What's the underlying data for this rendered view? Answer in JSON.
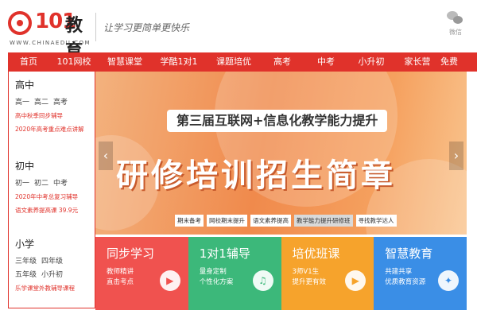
{
  "header": {
    "logo_number": "101",
    "logo_text": "教育",
    "logo_domain": "WWW.CHINAEDU.COM",
    "slogan": "让学习更简单更快乐",
    "wechat_label": "微信"
  },
  "nav": {
    "items": [
      "首页",
      "101网校",
      "智慧课堂",
      "学酷1对1",
      "课题培优",
      "高考",
      "中考",
      "小升初",
      "家长营",
      "免费"
    ]
  },
  "sidebar": {
    "sections": [
      {
        "title": "高中",
        "grades": [
          "高一",
          "高二",
          "高考"
        ],
        "links": [
          "高中秋季同步辅导",
          "2020年高考重点难点讲解"
        ]
      },
      {
        "title": "初中",
        "grades": [
          "初一",
          "初二",
          "中考"
        ],
        "links": [
          "2020年中考总复习辅导",
          "语文素养提高课 39.9元"
        ]
      },
      {
        "title": "小学",
        "grades": [
          "三年级",
          "四年级",
          "五年级",
          "小升初"
        ],
        "links": [
          "乐学课堂外教辅导课程"
        ]
      }
    ]
  },
  "banner": {
    "headline": "第三届互联网+信息化教学能力提升",
    "title": "研修培训招生简章",
    "tabs": [
      "期末备考",
      "网校期末提升",
      "语文素养提高",
      "教学能力提升研修班",
      "寻找教学达人"
    ],
    "active_tab": 3,
    "prev_arrow": "‹",
    "next_arrow": "›"
  },
  "cards": [
    {
      "title": "同步学习",
      "line1": "教师精讲",
      "line2": "直击考点",
      "color": "#f0524f",
      "icon": "play-book-icon",
      "glyph": "▶"
    },
    {
      "title": "1对1辅导",
      "line1": "量身定制",
      "line2": "个性化方案",
      "color": "#3cb87a",
      "icon": "headset-icon",
      "glyph": "♫"
    },
    {
      "title": "培优班课",
      "line1": "3师V1生",
      "line2": "提升更有效",
      "color": "#f6a32c",
      "icon": "play-icon",
      "glyph": "▶"
    },
    {
      "title": "智慧教育",
      "line1": "共建共享",
      "line2": "优质教育资源",
      "color": "#3a8ee6",
      "icon": "smart-brain-icon",
      "glyph": "✦"
    }
  ],
  "colors": {
    "brand": "#e0322b"
  }
}
